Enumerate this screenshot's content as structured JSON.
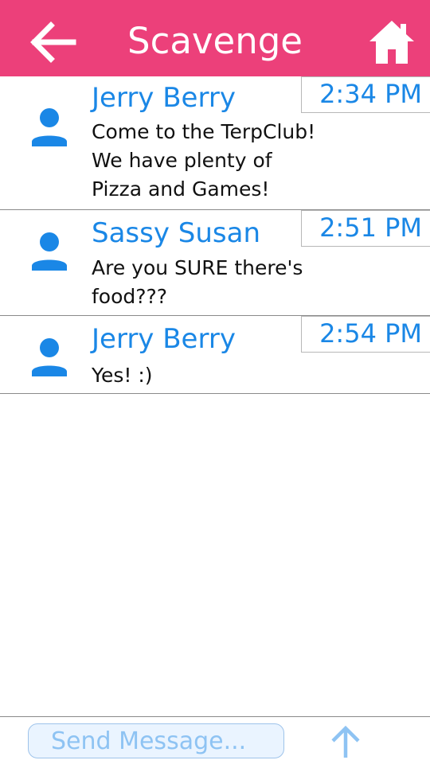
{
  "header": {
    "title": "Scavenge",
    "back_icon": "arrow-left-icon",
    "home_icon": "home-icon",
    "color": "#ec407a"
  },
  "messages": [
    {
      "sender": "Jerry Berry",
      "time": "2:34 PM",
      "text": "Come to the TerpClub!\nWe have plenty of\nPizza and Games!",
      "avatar_icon": "person-icon"
    },
    {
      "sender": "Sassy Susan",
      "time": "2:51 PM",
      "text": "Are you SURE there's\nfood???",
      "avatar_icon": "person-icon"
    },
    {
      "sender": "Jerry Berry",
      "time": "2:54 PM",
      "text": "Yes! :)",
      "avatar_icon": "person-icon"
    }
  ],
  "composer": {
    "placeholder": "Send Message...",
    "value": "",
    "send_icon": "arrow-up-icon"
  },
  "colors": {
    "accent": "#1a87e6",
    "header": "#ec407a",
    "input_bg": "#eaf4ff",
    "send_icon": "#8ec3f3"
  }
}
